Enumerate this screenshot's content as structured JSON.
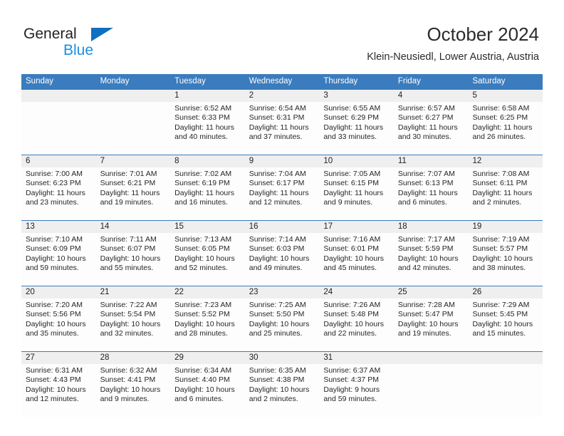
{
  "brand": {
    "name_part1": "General",
    "name_part2": "Blue",
    "triangle_color": "#0f6fc0",
    "blue_text_color": "#1a8fe3"
  },
  "header": {
    "title": "October 2024",
    "subtitle": "Klein-Neusiedl, Lower Austria, Austria"
  },
  "theme": {
    "header_bar_color": "#3a7cbe",
    "date_band_color": "#efefef",
    "cell_background": "#fdfdfd",
    "text_color": "#262626"
  },
  "weekdays": [
    "Sunday",
    "Monday",
    "Tuesday",
    "Wednesday",
    "Thursday",
    "Friday",
    "Saturday"
  ],
  "weeks": [
    {
      "days": [
        {
          "date": "",
          "lines": [
            "",
            "",
            "",
            ""
          ]
        },
        {
          "date": "",
          "lines": [
            "",
            "",
            "",
            ""
          ]
        },
        {
          "date": "1",
          "lines": [
            "Sunrise: 6:52 AM",
            "Sunset: 6:33 PM",
            "Daylight: 11 hours",
            "and 40 minutes."
          ]
        },
        {
          "date": "2",
          "lines": [
            "Sunrise: 6:54 AM",
            "Sunset: 6:31 PM",
            "Daylight: 11 hours",
            "and 37 minutes."
          ]
        },
        {
          "date": "3",
          "lines": [
            "Sunrise: 6:55 AM",
            "Sunset: 6:29 PM",
            "Daylight: 11 hours",
            "and 33 minutes."
          ]
        },
        {
          "date": "4",
          "lines": [
            "Sunrise: 6:57 AM",
            "Sunset: 6:27 PM",
            "Daylight: 11 hours",
            "and 30 minutes."
          ]
        },
        {
          "date": "5",
          "lines": [
            "Sunrise: 6:58 AM",
            "Sunset: 6:25 PM",
            "Daylight: 11 hours",
            "and 26 minutes."
          ]
        }
      ]
    },
    {
      "days": [
        {
          "date": "6",
          "lines": [
            "Sunrise: 7:00 AM",
            "Sunset: 6:23 PM",
            "Daylight: 11 hours",
            "and 23 minutes."
          ]
        },
        {
          "date": "7",
          "lines": [
            "Sunrise: 7:01 AM",
            "Sunset: 6:21 PM",
            "Daylight: 11 hours",
            "and 19 minutes."
          ]
        },
        {
          "date": "8",
          "lines": [
            "Sunrise: 7:02 AM",
            "Sunset: 6:19 PM",
            "Daylight: 11 hours",
            "and 16 minutes."
          ]
        },
        {
          "date": "9",
          "lines": [
            "Sunrise: 7:04 AM",
            "Sunset: 6:17 PM",
            "Daylight: 11 hours",
            "and 12 minutes."
          ]
        },
        {
          "date": "10",
          "lines": [
            "Sunrise: 7:05 AM",
            "Sunset: 6:15 PM",
            "Daylight: 11 hours",
            "and 9 minutes."
          ]
        },
        {
          "date": "11",
          "lines": [
            "Sunrise: 7:07 AM",
            "Sunset: 6:13 PM",
            "Daylight: 11 hours",
            "and 6 minutes."
          ]
        },
        {
          "date": "12",
          "lines": [
            "Sunrise: 7:08 AM",
            "Sunset: 6:11 PM",
            "Daylight: 11 hours",
            "and 2 minutes."
          ]
        }
      ]
    },
    {
      "days": [
        {
          "date": "13",
          "lines": [
            "Sunrise: 7:10 AM",
            "Sunset: 6:09 PM",
            "Daylight: 10 hours",
            "and 59 minutes."
          ]
        },
        {
          "date": "14",
          "lines": [
            "Sunrise: 7:11 AM",
            "Sunset: 6:07 PM",
            "Daylight: 10 hours",
            "and 55 minutes."
          ]
        },
        {
          "date": "15",
          "lines": [
            "Sunrise: 7:13 AM",
            "Sunset: 6:05 PM",
            "Daylight: 10 hours",
            "and 52 minutes."
          ]
        },
        {
          "date": "16",
          "lines": [
            "Sunrise: 7:14 AM",
            "Sunset: 6:03 PM",
            "Daylight: 10 hours",
            "and 49 minutes."
          ]
        },
        {
          "date": "17",
          "lines": [
            "Sunrise: 7:16 AM",
            "Sunset: 6:01 PM",
            "Daylight: 10 hours",
            "and 45 minutes."
          ]
        },
        {
          "date": "18",
          "lines": [
            "Sunrise: 7:17 AM",
            "Sunset: 5:59 PM",
            "Daylight: 10 hours",
            "and 42 minutes."
          ]
        },
        {
          "date": "19",
          "lines": [
            "Sunrise: 7:19 AM",
            "Sunset: 5:57 PM",
            "Daylight: 10 hours",
            "and 38 minutes."
          ]
        }
      ]
    },
    {
      "days": [
        {
          "date": "20",
          "lines": [
            "Sunrise: 7:20 AM",
            "Sunset: 5:56 PM",
            "Daylight: 10 hours",
            "and 35 minutes."
          ]
        },
        {
          "date": "21",
          "lines": [
            "Sunrise: 7:22 AM",
            "Sunset: 5:54 PM",
            "Daylight: 10 hours",
            "and 32 minutes."
          ]
        },
        {
          "date": "22",
          "lines": [
            "Sunrise: 7:23 AM",
            "Sunset: 5:52 PM",
            "Daylight: 10 hours",
            "and 28 minutes."
          ]
        },
        {
          "date": "23",
          "lines": [
            "Sunrise: 7:25 AM",
            "Sunset: 5:50 PM",
            "Daylight: 10 hours",
            "and 25 minutes."
          ]
        },
        {
          "date": "24",
          "lines": [
            "Sunrise: 7:26 AM",
            "Sunset: 5:48 PM",
            "Daylight: 10 hours",
            "and 22 minutes."
          ]
        },
        {
          "date": "25",
          "lines": [
            "Sunrise: 7:28 AM",
            "Sunset: 5:47 PM",
            "Daylight: 10 hours",
            "and 19 minutes."
          ]
        },
        {
          "date": "26",
          "lines": [
            "Sunrise: 7:29 AM",
            "Sunset: 5:45 PM",
            "Daylight: 10 hours",
            "and 15 minutes."
          ]
        }
      ]
    },
    {
      "days": [
        {
          "date": "27",
          "lines": [
            "Sunrise: 6:31 AM",
            "Sunset: 4:43 PM",
            "Daylight: 10 hours",
            "and 12 minutes."
          ]
        },
        {
          "date": "28",
          "lines": [
            "Sunrise: 6:32 AM",
            "Sunset: 4:41 PM",
            "Daylight: 10 hours",
            "and 9 minutes."
          ]
        },
        {
          "date": "29",
          "lines": [
            "Sunrise: 6:34 AM",
            "Sunset: 4:40 PM",
            "Daylight: 10 hours",
            "and 6 minutes."
          ]
        },
        {
          "date": "30",
          "lines": [
            "Sunrise: 6:35 AM",
            "Sunset: 4:38 PM",
            "Daylight: 10 hours",
            "and 2 minutes."
          ]
        },
        {
          "date": "31",
          "lines": [
            "Sunrise: 6:37 AM",
            "Sunset: 4:37 PM",
            "Daylight: 9 hours",
            "and 59 minutes."
          ]
        },
        {
          "date": "",
          "lines": [
            "",
            "",
            "",
            ""
          ]
        },
        {
          "date": "",
          "lines": [
            "",
            "",
            "",
            ""
          ]
        }
      ]
    }
  ]
}
